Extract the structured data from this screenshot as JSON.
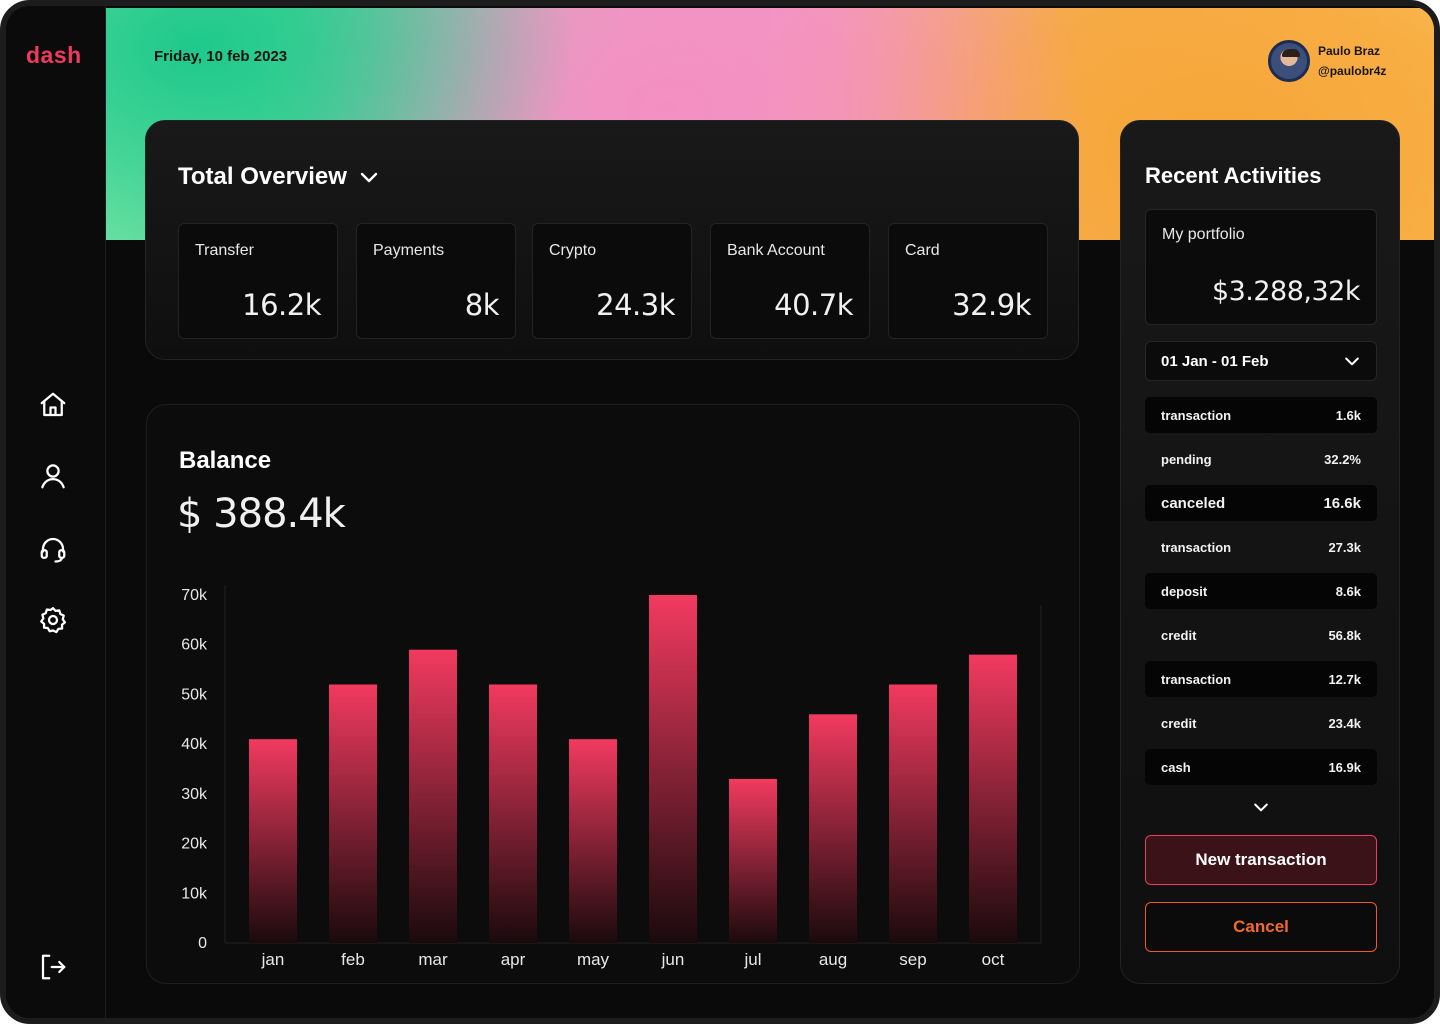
{
  "app": {
    "logo": "dash"
  },
  "header": {
    "date": "Friday, 10 feb 2023",
    "user": {
      "name": "Paulo Braz",
      "handle": "@paulobr4z"
    }
  },
  "sidebar": {
    "icons": [
      "home-icon",
      "user-icon",
      "headset-icon",
      "settings-icon",
      "logout-icon"
    ]
  },
  "overview": {
    "title": "Total Overview",
    "stats": [
      {
        "label": "Transfer",
        "value": "16.2k"
      },
      {
        "label": "Payments",
        "value": "8k"
      },
      {
        "label": "Crypto",
        "value": "24.3k"
      },
      {
        "label": "Bank Account",
        "value": "40.7k"
      },
      {
        "label": "Card",
        "value": "32.9k"
      }
    ]
  },
  "balance": {
    "title": "Balance",
    "value": "$ 388.4k"
  },
  "chart_data": {
    "type": "bar",
    "categories": [
      "jan",
      "feb",
      "mar",
      "apr",
      "may",
      "jun",
      "jul",
      "aug",
      "sep",
      "oct"
    ],
    "values": [
      41000,
      52000,
      59000,
      52000,
      41000,
      70000,
      33000,
      46000,
      52000,
      58000
    ],
    "yticks": [
      "0",
      "10k",
      "20k",
      "30k",
      "40k",
      "50k",
      "60k",
      "70k"
    ],
    "ylim": [
      0,
      70000
    ],
    "title": "",
    "xlabel": "",
    "ylabel": "",
    "colors": {
      "bar_top": "#f23a5f",
      "bar_bottom": "#1a0a0d"
    }
  },
  "activities": {
    "title": "Recent Activities",
    "portfolio": {
      "label": "My portfolio",
      "value": "$3.288,32k"
    },
    "date_range": "01 Jan - 01 Feb",
    "items": [
      {
        "label": "transaction",
        "value": "1.6k"
      },
      {
        "label": "pending",
        "value": "32.2%"
      },
      {
        "label": "canceled",
        "value": "16.6k"
      },
      {
        "label": "transaction",
        "value": "27.3k"
      },
      {
        "label": "deposit",
        "value": "8.6k"
      },
      {
        "label": "credit",
        "value": "56.8k"
      },
      {
        "label": "transaction",
        "value": "12.7k"
      },
      {
        "label": "credit",
        "value": "23.4k"
      },
      {
        "label": "cash",
        "value": "16.9k"
      }
    ],
    "buttons": {
      "primary": "New transaction",
      "cancel": "Cancel"
    }
  }
}
